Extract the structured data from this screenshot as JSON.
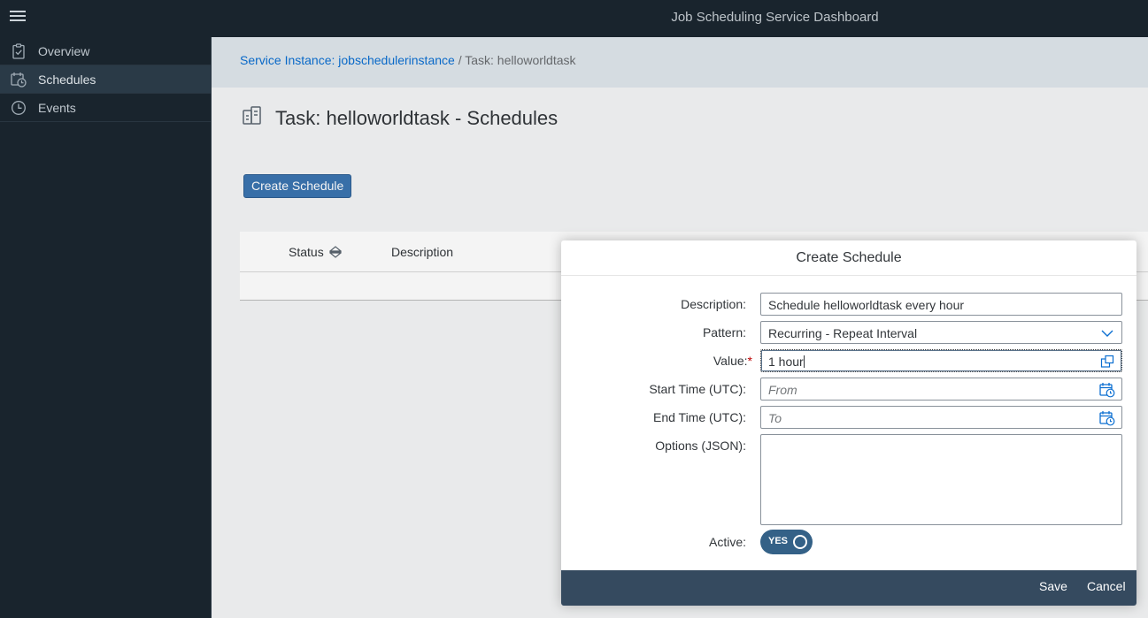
{
  "shell": {
    "title": "Job Scheduling Service Dashboard"
  },
  "sidebar": {
    "items": [
      {
        "label": "Overview",
        "icon": "clipboard-check-icon"
      },
      {
        "label": "Schedules",
        "icon": "calendar-clock-icon",
        "active": true
      },
      {
        "label": "Events",
        "icon": "clock-icon"
      }
    ]
  },
  "breadcrumb": {
    "link": "Service Instance: jobschedulerinstance",
    "separator": " / ",
    "current": "Task: helloworldtask"
  },
  "page": {
    "title": "Task: helloworldtask - Schedules",
    "create_button": "Create Schedule",
    "table": {
      "columns": [
        "Status",
        "Description"
      ]
    }
  },
  "dialog": {
    "title": "Create Schedule",
    "fields": {
      "description": {
        "label": "Description:",
        "value": "Schedule helloworldtask every hour"
      },
      "pattern": {
        "label": "Pattern:",
        "value": "Recurring - Repeat Interval"
      },
      "value": {
        "label": "Value:",
        "required_mark": "*",
        "value": "1 hour"
      },
      "start_time": {
        "label": "Start Time (UTC):",
        "placeholder": "From"
      },
      "end_time": {
        "label": "End Time (UTC):",
        "placeholder": "To"
      },
      "options": {
        "label": "Options (JSON):",
        "value": ""
      },
      "active": {
        "label": "Active:",
        "switch_text": "YES",
        "on": true
      }
    },
    "footer": {
      "save": "Save",
      "cancel": "Cancel"
    }
  },
  "colors": {
    "shell_bg": "#1b2630",
    "accent": "#3b75b0",
    "link": "#0a6ed1",
    "footer_bg": "#354a5f",
    "required": "#bb0000"
  }
}
